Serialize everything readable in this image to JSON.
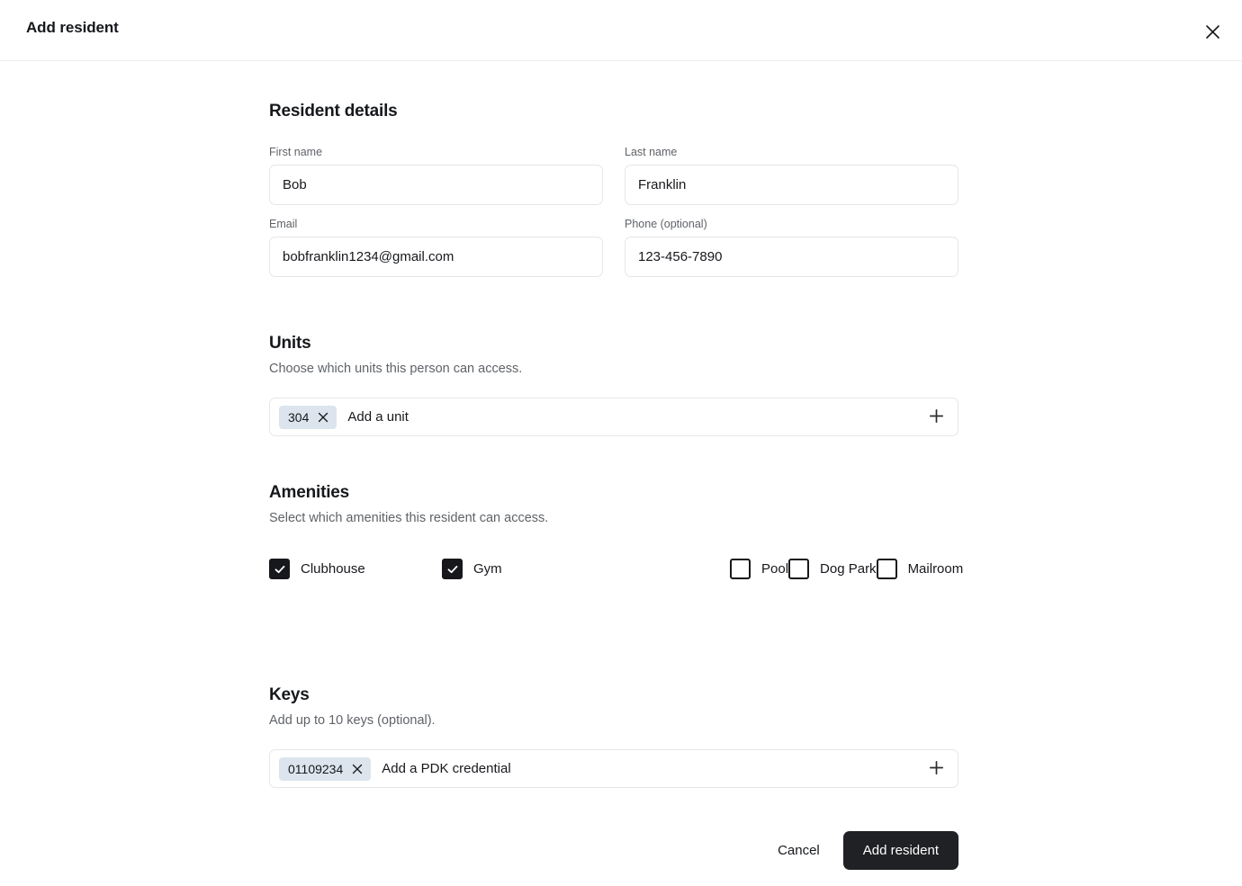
{
  "modal": {
    "title": "Add resident",
    "close_icon": "close-icon"
  },
  "resident_details": {
    "heading": "Resident details",
    "fields": [
      {
        "label": "First name",
        "value": "Bob",
        "placeholder": "First name"
      },
      {
        "label": "Last name",
        "value": "Franklin",
        "placeholder": "Last name"
      },
      {
        "label": "Email",
        "value": "bobfranklin1234@gmail.com",
        "placeholder": "Email"
      },
      {
        "label": "Phone (optional)",
        "value": "123-456-7890",
        "placeholder": "Phone"
      }
    ]
  },
  "units": {
    "heading": "Units",
    "description": "Choose which units this person can access.",
    "chips": [
      {
        "label": "304",
        "remove_icon": "close-icon"
      }
    ],
    "placeholder": "Add a unit",
    "add_icon": "plus-icon"
  },
  "amenities": {
    "heading": "Amenities",
    "description": "Select which amenities this resident can access.",
    "items": [
      {
        "label": "Clubhouse",
        "checked": true
      },
      {
        "label": "Gym",
        "checked": true
      },
      {
        "label": "Pool",
        "checked": false
      },
      {
        "label": "Dog Park",
        "checked": false
      },
      {
        "label": "Mailroom",
        "checked": false
      }
    ]
  },
  "keys": {
    "heading": "Keys",
    "description": "Add up to 10 keys (optional).",
    "chips": [
      {
        "label": "01109234",
        "remove_icon": "close-icon"
      }
    ],
    "placeholder": "Add a PDK credential",
    "add_icon": "plus-icon"
  },
  "footer": {
    "cancel_label": "Cancel",
    "submit_label": "Add resident"
  },
  "colors": {
    "text": "#16181c",
    "muted": "#5f6368",
    "border": "#e4e6e8",
    "chip_bg": "#dce5ed",
    "primary_button_bg": "#202124",
    "surface": "#ffffff"
  }
}
